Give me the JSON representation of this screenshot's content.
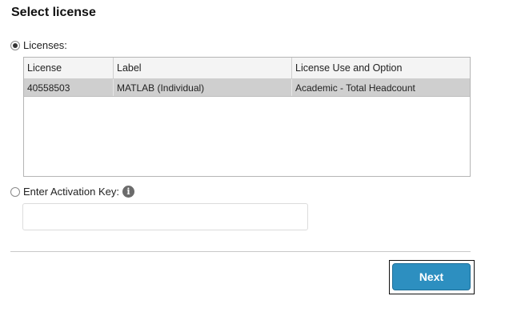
{
  "page": {
    "title": "Select license"
  },
  "licenses_option": {
    "label": "Licenses:",
    "selected": true
  },
  "table": {
    "columns": [
      "License",
      "Label",
      "License Use and Option"
    ],
    "rows": [
      {
        "license": "40558503",
        "label": "MATLAB (Individual)",
        "use": "Academic - Total Headcount",
        "selected": true
      }
    ]
  },
  "activation_option": {
    "label": "Enter Activation Key:",
    "selected": false,
    "info_icon": "info-icon",
    "value": "",
    "placeholder": ""
  },
  "actions": {
    "next_label": "Next"
  },
  "colors": {
    "primary_button": "#2d8fc0",
    "selected_row": "#cfcfcf"
  }
}
